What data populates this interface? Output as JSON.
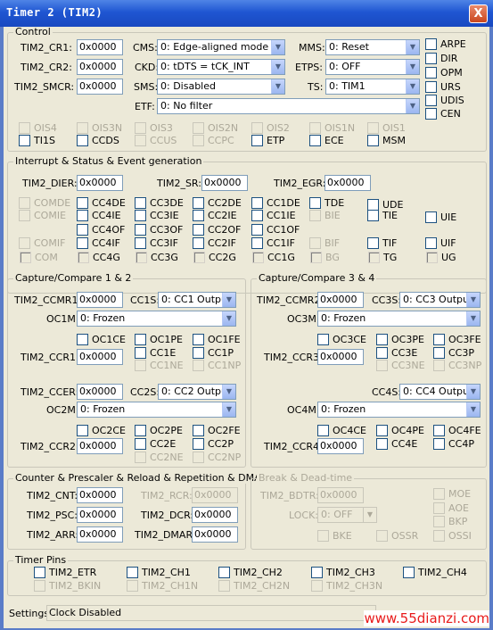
{
  "window": {
    "title": "Timer 2 (TIM2)",
    "close": "X"
  },
  "control": {
    "title": "Control",
    "cr1_label": "TIM2_CR1:",
    "cr1": "0x0000",
    "cr2_label": "TIM2_CR2:",
    "cr2": "0x0000",
    "smcr_label": "TIM2_SMCR:",
    "smcr": "0x0000",
    "cms_label": "CMS:",
    "cms": "0: Edge-aligned mode",
    "ckd_label": "CKD:",
    "ckd": "0: tDTS = tCK_INT",
    "sms_label": "SMS:",
    "sms": "0: Disabled",
    "etf_label": "ETF:",
    "etf": "0:  No filter",
    "mms_label": "MMS:",
    "mms": "0: Reset",
    "etps_label": "ETPS:",
    "etps": "0: OFF",
    "ts_label": "TS:",
    "ts": "0: TIM1",
    "arpe": "ARPE",
    "dir": "DIR",
    "opm": "OPM",
    "urs": "URS",
    "udis": "UDIS",
    "cen": "CEN",
    "row1": [
      "OIS4",
      "OIS3N",
      "OIS3",
      "OIS2N",
      "OIS2",
      "OIS1N",
      "OIS1"
    ],
    "row2": [
      "TI1S",
      "CCDS",
      "CCUS",
      "CCPC",
      "ETP",
      "ECE",
      "MSM"
    ]
  },
  "irq": {
    "title": "Interrupt & Status & Event generation",
    "dier_label": "TIM2_DIER:",
    "dier": "0x0000",
    "sr_label": "TIM2_SR:",
    "sr": "0x0000",
    "egr_label": "TIM2_EGR:",
    "egr": "0x0000",
    "r1": [
      "COMDE",
      "CC4DE",
      "CC3DE",
      "CC2DE",
      "CC1DE",
      "TDE",
      "UDE"
    ],
    "r2": [
      "COMIE",
      "CC4IE",
      "CC3IE",
      "CC2IE",
      "CC1IE",
      "BIE",
      "TIE",
      "UIE"
    ],
    "r3": [
      "CC4OF",
      "CC3OF",
      "CC2OF",
      "CC1OF"
    ],
    "r4": [
      "COMIF",
      "CC4IF",
      "CC3IF",
      "CC2IF",
      "CC1IF",
      "BIF",
      "TIF",
      "UIF"
    ],
    "r5": [
      "COM",
      "CC4G",
      "CC3G",
      "CC2G",
      "CC1G",
      "BG",
      "TG",
      "UG"
    ]
  },
  "cc12": {
    "title": "Capture/Compare 1 & 2",
    "ccmr1_label": "TIM2_CCMR1:",
    "ccmr1": "0x0000",
    "cc1s_label": "CC1S:",
    "cc1s": "0: CC1 Output",
    "oc1m_label": "OC1M:",
    "oc1m": "0: Frozen",
    "oc1ce": "OC1CE",
    "oc1pe": "OC1PE",
    "oc1fe": "OC1FE",
    "ccr1_label": "TIM2_CCR1:",
    "ccr1": "0x0000",
    "cc1e": "CC1E",
    "cc1p": "CC1P",
    "cc1ne": "CC1NE",
    "cc1np": "CC1NP",
    "ccer_label": "TIM2_CCER:",
    "ccer": "0x0000",
    "cc2s_label": "CC2S:",
    "cc2s": "0: CC2 Output",
    "oc2m_label": "OC2M:",
    "oc2m": "0: Frozen",
    "oc2ce": "OC2CE",
    "oc2pe": "OC2PE",
    "oc2fe": "OC2FE",
    "ccr2_label": "TIM2_CCR2:",
    "ccr2": "0x0000",
    "cc2e": "CC2E",
    "cc2p": "CC2P",
    "cc2ne": "CC2NE",
    "cc2np": "CC2NP"
  },
  "cc34": {
    "title": "Capture/Compare 3 & 4",
    "ccmr2_label": "TIM2_CCMR2:",
    "ccmr2": "0x0000",
    "cc3s_label": "CC3S:",
    "cc3s": "0: CC3 Output",
    "oc3m_label": "OC3M:",
    "oc3m": "0: Frozen",
    "oc3ce": "OC3CE",
    "oc3pe": "OC3PE",
    "oc3fe": "OC3FE",
    "ccr3_label": "TIM2_CCR3:",
    "ccr3": "0x0000",
    "cc3e": "CC3E",
    "cc3p": "CC3P",
    "cc3ne": "CC3NE",
    "cc3np": "CC3NP",
    "cc4s_label": "CC4S:",
    "cc4s": "0: CC4 Output",
    "oc4m_label": "OC4M:",
    "oc4m": "0: Frozen",
    "oc4ce": "OC4CE",
    "oc4pe": "OC4PE",
    "oc4fe": "OC4FE",
    "ccr4_label": "TIM2_CCR4:",
    "ccr4": "0x0000",
    "cc4e": "CC4E",
    "cc4p": "CC4P"
  },
  "counter": {
    "title": "Counter & Prescaler & Reload & Repetition & DMA",
    "cnt_label": "TIM2_CNT:",
    "cnt": "0x0000",
    "psc_label": "TIM2_PSC:",
    "psc": "0x0000",
    "arr_label": "TIM2_ARR:",
    "arr": "0x0000",
    "rcr_label": "TIM2_RCR:",
    "rcr": "0x0000",
    "dcr_label": "TIM2_DCR:",
    "dcr": "0x0000",
    "dmar_label": "TIM2_DMAR:",
    "dmar": "0x0000"
  },
  "brk": {
    "title": "Break & Dead-time",
    "bdtr_label": "TIM2_BDTR:",
    "bdtr": "0x0000",
    "lock_label": "LOCK:",
    "lock": "0: OFF",
    "moe": "MOE",
    "aoe": "AOE",
    "bkp": "BKP",
    "bke": "BKE",
    "ossr": "OSSR",
    "ossi": "OSSI"
  },
  "pins": {
    "title": "Timer Pins",
    "etr": "TIM2_ETR",
    "ch1": "TIM2_CH1",
    "ch2": "TIM2_CH2",
    "ch3": "TIM2_CH3",
    "ch4": "TIM2_CH4",
    "bkin": "TIM2_BKIN",
    "ch1n": "TIM2_CH1N",
    "ch2n": "TIM2_CH2N",
    "ch3n": "TIM2_CH3N"
  },
  "status": {
    "label": "Settings:",
    "value": "Clock Disabled"
  },
  "watermark": "www.55dianzi.com"
}
